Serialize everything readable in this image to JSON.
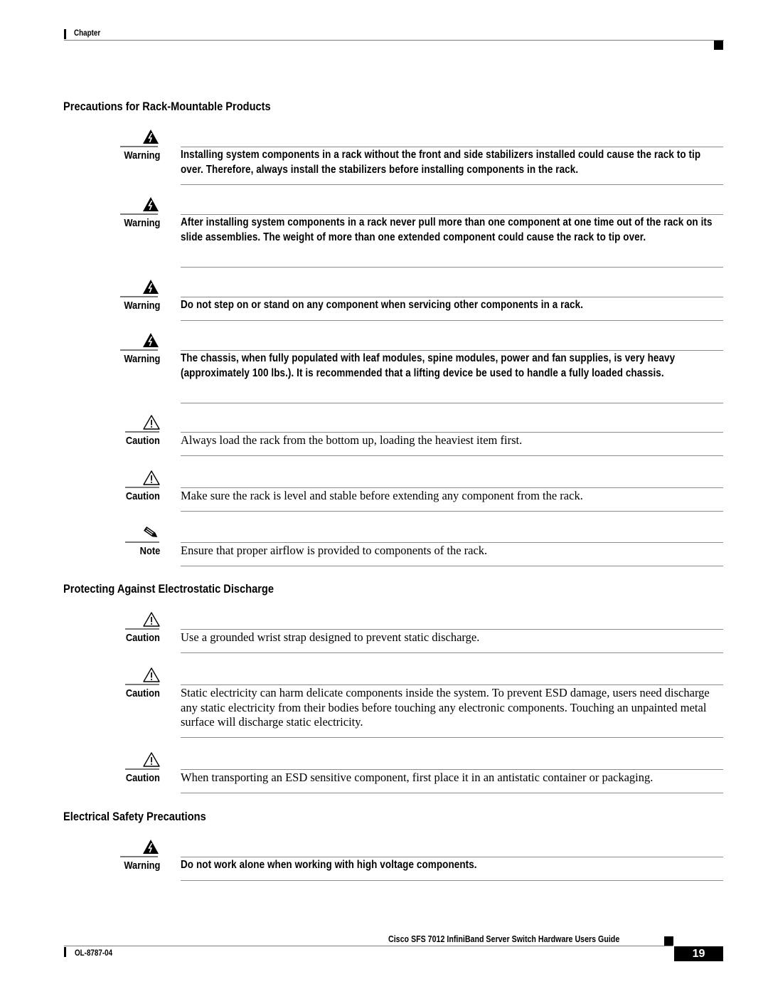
{
  "header": {
    "chapter_label": "Chapter"
  },
  "sections": [
    {
      "heading": "Precautions for Rack-Mountable Products",
      "notices": [
        {
          "kind": "Warning",
          "icon": "warning-lightning-icon",
          "style": "bold",
          "text": "Installing system components in a rack without the front and side stabilizers installed could cause the rack to tip over. Therefore, always install the stabilizers before installing components in the rack."
        },
        {
          "kind": "Warning",
          "icon": "warning-lightning-icon",
          "style": "bold",
          "text": "After installing system components in a rack never pull more than one component at one time out of the rack on its slide assemblies. The weight of more than one extended component could cause the rack to tip over."
        },
        {
          "kind": "Warning",
          "icon": "warning-lightning-icon",
          "style": "bold",
          "text": "Do not step on or stand on any component when servicing other components in a rack."
        },
        {
          "kind": "Warning",
          "icon": "warning-lightning-icon",
          "style": "bold",
          "text": "The chassis, when fully populated with leaf modules, spine modules, power and fan supplies, is very heavy (approximately 100 lbs.). It is recommended that a lifting device be used to handle a fully loaded chassis."
        },
        {
          "kind": "Caution",
          "icon": "caution-exclamation-icon",
          "style": "plain",
          "text": "Always load the rack from the bottom up, loading the heaviest item first."
        },
        {
          "kind": "Caution",
          "icon": "caution-exclamation-icon",
          "style": "plain",
          "text": "Make sure the rack is level and stable before extending any component from the rack."
        },
        {
          "kind": "Note",
          "icon": "note-pencil-icon",
          "style": "plain",
          "text": "Ensure that proper airflow is provided to components of the rack."
        }
      ]
    },
    {
      "heading": "Protecting Against Electrostatic Discharge",
      "notices": [
        {
          "kind": "Caution",
          "icon": "caution-exclamation-icon",
          "style": "plain",
          "text": "Use a grounded wrist strap designed to prevent static discharge."
        },
        {
          "kind": "Caution",
          "icon": "caution-exclamation-icon",
          "style": "plain",
          "text": "Static electricity can harm delicate components inside the system. To prevent ESD damage, users need discharge any static electricity from their bodies before touching any electronic components. Touching an unpainted metal surface will discharge static electricity."
        },
        {
          "kind": "Caution",
          "icon": "caution-exclamation-icon",
          "style": "plain",
          "text": "When transporting an ESD sensitive component, first place it in an antistatic container or packaging."
        }
      ]
    },
    {
      "heading": "Electrical Safety Precautions",
      "notices": [
        {
          "kind": "Warning",
          "icon": "warning-lightning-icon",
          "style": "bold",
          "text": "Do not work alone when working with high voltage components."
        }
      ]
    }
  ],
  "footer": {
    "guide_title": "Cisco SFS 7012 InfiniBand Server Switch Hardware Users Guide",
    "doc_number": "OL-8787-04",
    "page_number": "19"
  }
}
